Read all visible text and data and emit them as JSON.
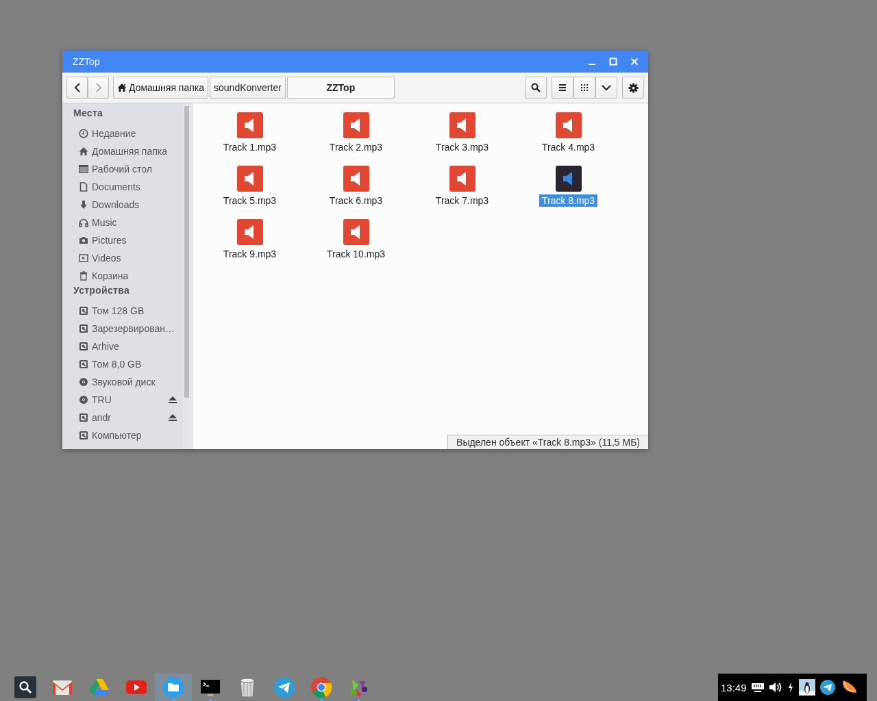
{
  "window": {
    "title": "ZZTop"
  },
  "toolbar": {
    "back_disabled": false,
    "forward_disabled": true,
    "breadcrumbs": [
      {
        "label": "Домашняя папка",
        "kind": "home",
        "selected": false
      },
      {
        "label": "soundKonverter",
        "kind": "folder",
        "selected": false
      },
      {
        "label": "ZZTop",
        "kind": "folder",
        "selected": true
      }
    ]
  },
  "sidebar": {
    "sections": [
      {
        "heading": "Места",
        "items": [
          {
            "label": "Недавние",
            "kind": "clock",
            "eject": false
          },
          {
            "label": "Домашняя папка",
            "kind": "home",
            "eject": false
          },
          {
            "label": "Рабочий стол",
            "kind": "desktop",
            "eject": false
          },
          {
            "label": "Documents",
            "kind": "document",
            "eject": false
          },
          {
            "label": "Downloads",
            "kind": "download",
            "eject": false
          },
          {
            "label": "Music",
            "kind": "headphones",
            "eject": false
          },
          {
            "label": "Pictures",
            "kind": "camera",
            "eject": false
          },
          {
            "label": "Videos",
            "kind": "video",
            "eject": false
          },
          {
            "label": "Корзина",
            "kind": "trash",
            "eject": false
          }
        ]
      },
      {
        "heading": "Устройства",
        "items": [
          {
            "label": "Том 128 GB",
            "kind": "drive",
            "eject": false
          },
          {
            "label": "Зарезервирован…",
            "kind": "drive",
            "eject": false
          },
          {
            "label": "Arhive",
            "kind": "drive",
            "eject": false
          },
          {
            "label": "Том 8,0 GB",
            "kind": "drive",
            "eject": false
          },
          {
            "label": "Звуковой диск",
            "kind": "disc",
            "eject": false
          },
          {
            "label": "TRU",
            "kind": "disc",
            "eject": true
          },
          {
            "label": "andr",
            "kind": "drive",
            "eject": true
          },
          {
            "label": "Компьютер",
            "kind": "drive",
            "eject": false
          }
        ]
      }
    ]
  },
  "files": [
    {
      "name": "Track 1.mp3",
      "selected": false
    },
    {
      "name": "Track 2.mp3",
      "selected": false
    },
    {
      "name": "Track 3.mp3",
      "selected": false
    },
    {
      "name": "Track 4.mp3",
      "selected": false
    },
    {
      "name": "Track 5.mp3",
      "selected": false
    },
    {
      "name": "Track 6.mp3",
      "selected": false
    },
    {
      "name": "Track 7.mp3",
      "selected": false
    },
    {
      "name": "Track 8.mp3",
      "selected": true
    },
    {
      "name": "Track 9.mp3",
      "selected": false
    },
    {
      "name": "Track 10.mp3",
      "selected": false
    }
  ],
  "status_bar": "Выделен объект «Track 8.mp3» (11,5 МБ)",
  "taskbar": {
    "apps": [
      {
        "kind": "search",
        "running": false,
        "active": false
      },
      {
        "kind": "mail",
        "running": false,
        "active": false
      },
      {
        "kind": "drive",
        "running": false,
        "active": false
      },
      {
        "kind": "video",
        "running": false,
        "active": false
      },
      {
        "kind": "files",
        "running": true,
        "active": true
      },
      {
        "kind": "terminal",
        "running": true,
        "active": false
      },
      {
        "kind": "trash",
        "running": false,
        "active": false
      },
      {
        "kind": "telegram",
        "running": false,
        "active": false
      },
      {
        "kind": "browser",
        "running": true,
        "active": false
      },
      {
        "kind": "music",
        "running": true,
        "active": false
      }
    ],
    "tray": {
      "time": "13:49"
    }
  }
}
